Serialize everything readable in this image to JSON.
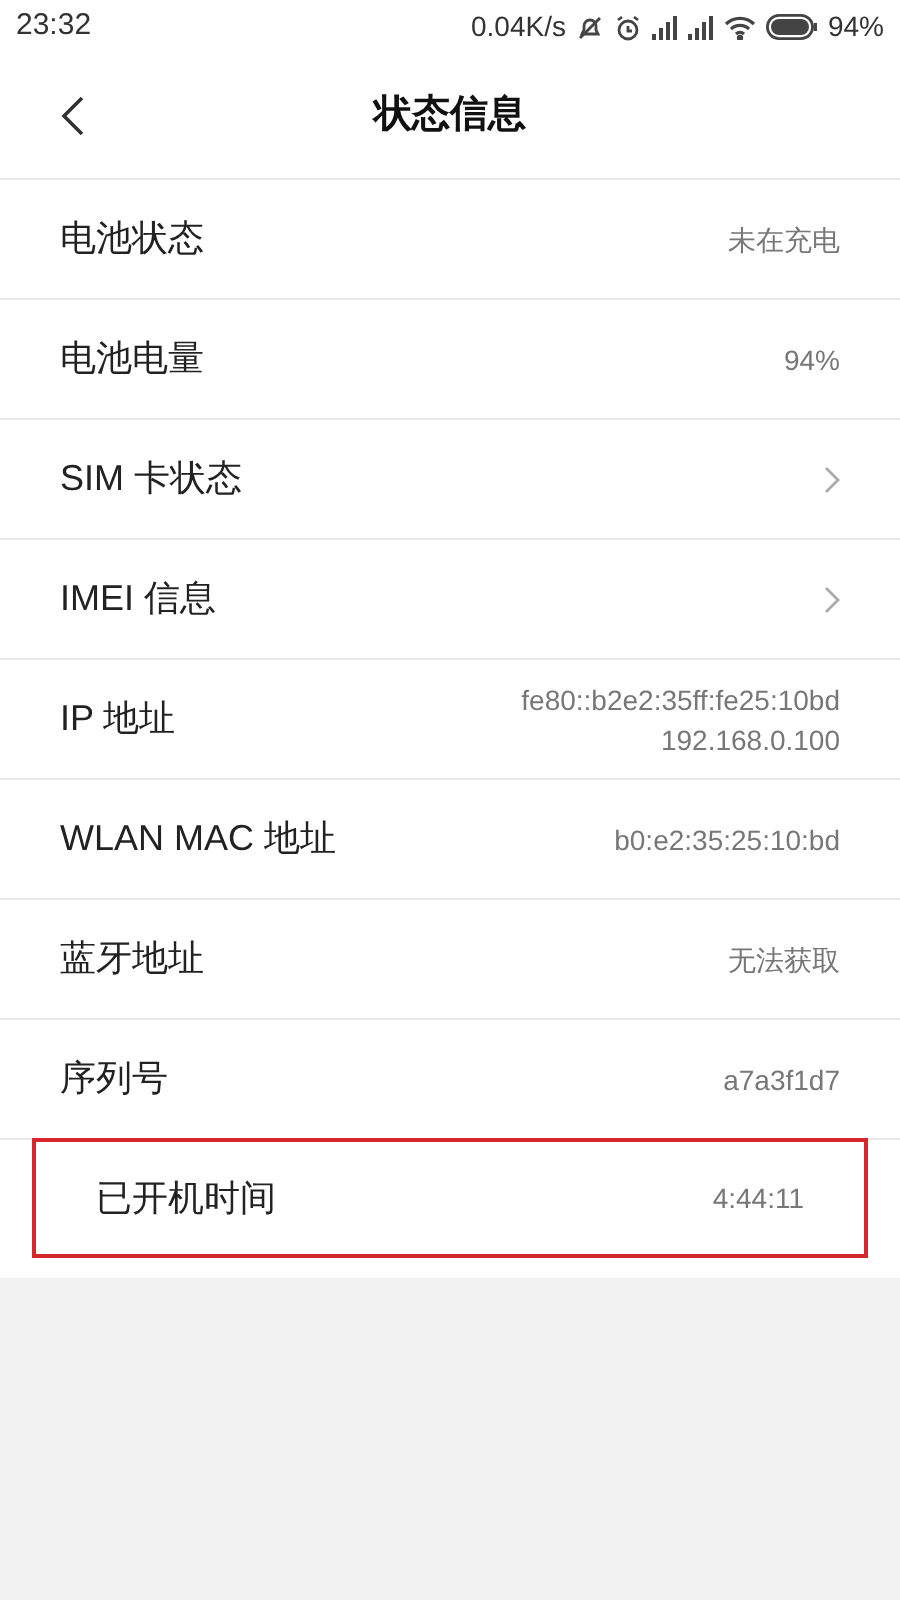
{
  "status_bar": {
    "time": "23:32",
    "speed": "0.04K/s",
    "battery": "94%"
  },
  "header": {
    "title": "状态信息"
  },
  "rows": [
    {
      "kind": "value",
      "label": "电池状态",
      "values": [
        "未在充电"
      ],
      "highlighted": false
    },
    {
      "kind": "value",
      "label": "电池电量",
      "values": [
        "94%"
      ],
      "highlighted": false
    },
    {
      "kind": "link",
      "label": "SIM 卡状态",
      "highlighted": false
    },
    {
      "kind": "link",
      "label": "IMEI 信息",
      "highlighted": false
    },
    {
      "kind": "value",
      "label": "IP 地址",
      "values": [
        "fe80::b2e2:35ff:fe25:10bd",
        "192.168.0.100"
      ],
      "highlighted": false
    },
    {
      "kind": "value",
      "label": "WLAN MAC 地址",
      "values": [
        "b0:e2:35:25:10:bd"
      ],
      "highlighted": false
    },
    {
      "kind": "value",
      "label": "蓝牙地址",
      "values": [
        "无法获取"
      ],
      "highlighted": false
    },
    {
      "kind": "value",
      "label": "序列号",
      "values": [
        "a7a3f1d7"
      ],
      "highlighted": false
    },
    {
      "kind": "value",
      "label": "已开机时间",
      "values": [
        "4:44:11"
      ],
      "highlighted": true
    }
  ]
}
